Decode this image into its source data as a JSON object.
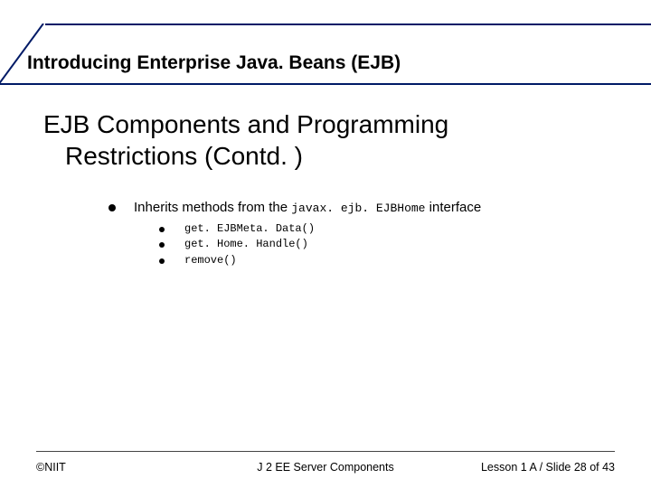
{
  "header": {
    "title": "Introducing Enterprise Java. Beans (EJB)"
  },
  "body": {
    "title_line1": "EJB Components and Programming",
    "title_line2": "Restrictions (Contd. )",
    "bullet_prefix": "Inherits methods from the ",
    "bullet_code": "javax. ejb. EJBHome",
    "bullet_suffix": " interface",
    "methods": [
      "get. EJBMeta. Data()",
      "get. Home. Handle()",
      "remove()"
    ]
  },
  "footer": {
    "left": "©NIIT",
    "center": "J 2 EE Server Components",
    "right": "Lesson 1 A / Slide 28 of 43"
  }
}
